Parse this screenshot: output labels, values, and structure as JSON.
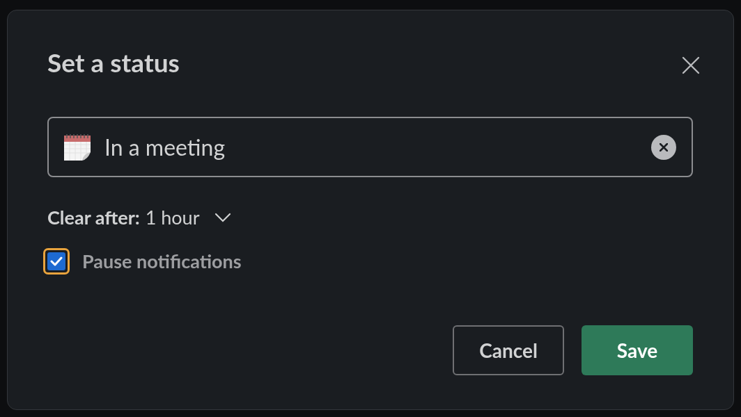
{
  "dialog": {
    "title": "Set a status",
    "status_field": {
      "value": "In a meeting"
    },
    "clear_after": {
      "label": "Clear after:",
      "value": "1 hour"
    },
    "pause_notifications": {
      "label": "Pause notifications",
      "checked": true,
      "focused": true
    },
    "buttons": [
      {
        "label": "Cancel",
        "kind": "secondary"
      },
      {
        "label": "Save",
        "kind": "primary"
      }
    ]
  }
}
